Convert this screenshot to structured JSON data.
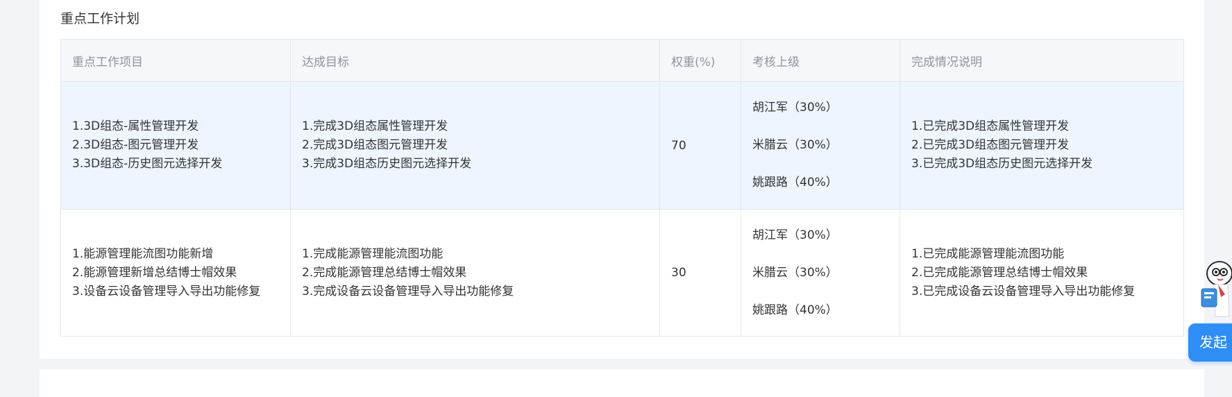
{
  "section": {
    "title": "重点工作计划"
  },
  "table": {
    "headers": [
      "重点工作项目",
      "达成目标",
      "权重(%)",
      "考核上级",
      "完成情况说明"
    ],
    "rows": [
      {
        "items": [
          "1.3D组态-属性管理开发",
          "2.3D组态-图元管理开发",
          "3.3D组态-历史图元选择开发"
        ],
        "goals": [
          "1.完成3D组态属性管理开发",
          "2.完成3D组态图元管理开发",
          "3.完成3D组态历史图元选择开发"
        ],
        "weight": "70",
        "reviewers": [
          "胡江军（30%）",
          "米腊云（30%）",
          "姚跟路（40%）"
        ],
        "completion": [
          "1.已完成3D组态属性管理开发",
          "2.已完成3D组态图元管理开发",
          "3.已完成3D组态历史图元选择开发"
        ]
      },
      {
        "items": [
          "1.能源管理能流图功能新增",
          "2.能源管理新增总结博士帽效果",
          "3.设备云设备管理导入导出功能修复"
        ],
        "goals": [
          "1.完成能源管理能流图功能",
          "2.完成能源管理总结博士帽效果",
          "3.完成设备云设备管理导入导出功能修复"
        ],
        "weight": "30",
        "reviewers": [
          "胡江军（30%）",
          "米腊云（30%）",
          "姚跟路（40%）"
        ],
        "completion": [
          "1.已完成能源管理能流图功能",
          "2.已完成能源管理总结博士帽效果",
          "3.已完成设备云设备管理导入导出功能修复"
        ]
      }
    ]
  },
  "assistant": {
    "button_label": "发起"
  },
  "colors": {
    "header_bg": "#f5f7fa",
    "highlight_row_bg": "#eef5ff",
    "accent": "#2f8ef5"
  }
}
